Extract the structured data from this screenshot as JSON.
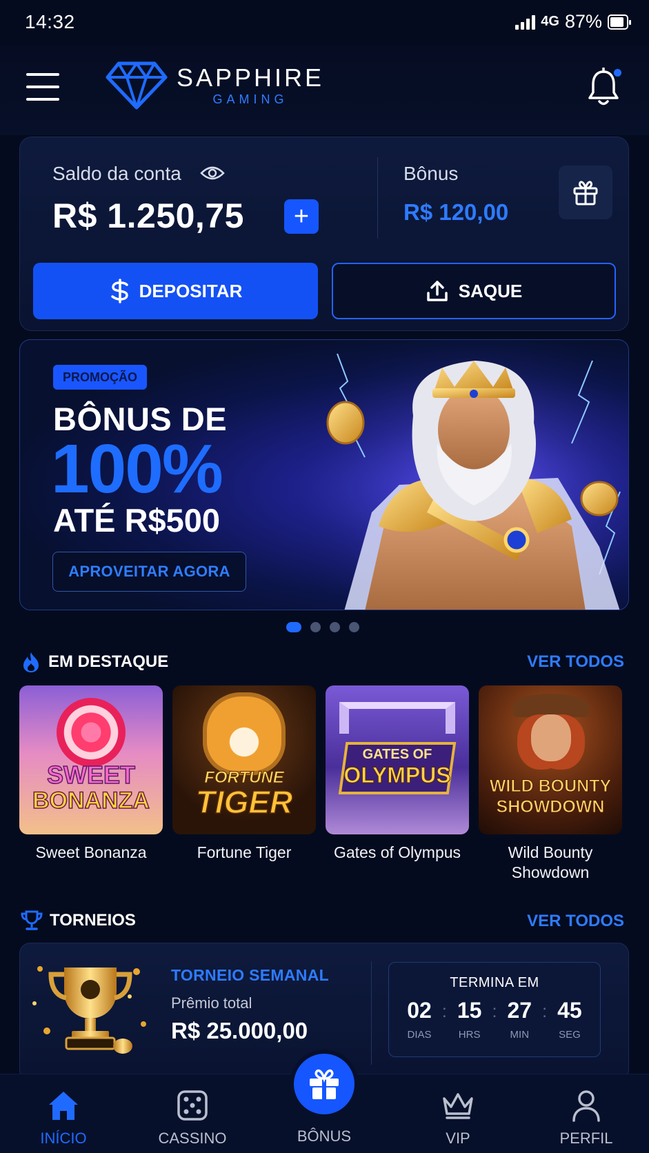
{
  "status": {
    "time": "14:32",
    "network": "4G",
    "battery": "87%"
  },
  "brand": {
    "name": "SAPPHIRE",
    "sub": "GAMING"
  },
  "balance": {
    "label": "Saldo da conta",
    "value": "R$ 1.250,75",
    "add": "+",
    "bonus_label": "Bônus",
    "bonus_value": "R$ 120,00",
    "deposit": "DEPOSITAR",
    "withdraw": "SAQUE"
  },
  "promo": {
    "tag": "PROMOÇÃO",
    "line1": "BÔNUS DE",
    "line2": "100%",
    "line3": "ATÉ R$500",
    "cta": "APROVEITAR AGORA",
    "slides": 4,
    "active_slide": 1
  },
  "featured": {
    "title": "EM DESTAQUE",
    "link": "VER TODOS",
    "games": [
      {
        "name": "Sweet Bonanza",
        "thumb_title": [
          "SWEET",
          "BONANZA"
        ]
      },
      {
        "name": "Fortune Tiger",
        "thumb_title": [
          "FORTUNE",
          "TIGER"
        ]
      },
      {
        "name": "Gates of Olympus",
        "thumb_title": [
          "GATES OF",
          "OLYMPUS"
        ]
      },
      {
        "name": "Wild Bounty Showdown",
        "thumb_title": [
          "WILD BOUNTY",
          "SHOWDOWN"
        ]
      }
    ]
  },
  "tournaments": {
    "title": "TORNEIOS",
    "link": "VER TODOS",
    "card": {
      "name": "TORNEIO SEMANAL",
      "prize_label": "Prêmio total",
      "prize": "R$ 25.000,00",
      "ends_label": "TERMINA EM",
      "timer": [
        {
          "value": "02",
          "unit": "DIAS"
        },
        {
          "value": "15",
          "unit": "HRS"
        },
        {
          "value": "27",
          "unit": "MIN"
        },
        {
          "value": "45",
          "unit": "SEG"
        }
      ]
    }
  },
  "nav": {
    "home": "INÍCIO",
    "casino": "CASSINO",
    "bonus": "BÔNUS",
    "vip": "VIP",
    "profile": "PERFIL"
  },
  "colors": {
    "accent": "#1f6bff",
    "background": "#050b1e",
    "card": "#0e1a3d"
  }
}
